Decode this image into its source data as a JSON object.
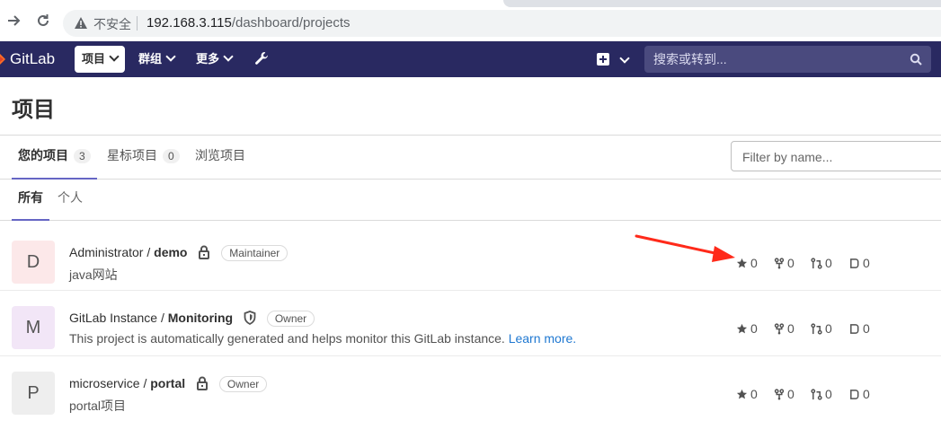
{
  "browser": {
    "insecure_label": "不安全",
    "url_host": "192.168.3.115",
    "url_path": "/dashboard/projects"
  },
  "header": {
    "brand": "GitLab",
    "menus": [
      "项目",
      "群组",
      "更多"
    ],
    "search_placeholder": "搜索或转到..."
  },
  "page": {
    "title": "项目",
    "tabs": [
      {
        "label": "您的项目",
        "count": "3"
      },
      {
        "label": "星标项目",
        "count": "0"
      },
      {
        "label": "浏览项目",
        "count": ""
      }
    ],
    "filter_placeholder": "Filter by name...",
    "subtabs": [
      "所有",
      "个人"
    ]
  },
  "projects": [
    {
      "avatar_letter": "D",
      "avatar_color": "#fce8e9",
      "namespace": "Administrator / ",
      "name": "demo",
      "visibility_icon": "lock-icon",
      "role": "Maintainer",
      "description": "java网站",
      "link_text": "",
      "stars": "0",
      "forks": "0",
      "merge_requests": "0",
      "issues": "0"
    },
    {
      "avatar_letter": "M",
      "avatar_color": "#f2e6f7",
      "namespace": "GitLab Instance / ",
      "name": "Monitoring",
      "visibility_icon": "shield-icon",
      "role": "Owner",
      "description": "This project is automatically generated and helps monitor this GitLab instance. ",
      "link_text": "Learn more.",
      "stars": "0",
      "forks": "0",
      "merge_requests": "0",
      "issues": "0"
    },
    {
      "avatar_letter": "P",
      "avatar_color": "#eeeeee",
      "namespace": "microservice / ",
      "name": "portal",
      "visibility_icon": "lock-icon",
      "role": "Owner",
      "description": "portal项目",
      "link_text": "",
      "stars": "0",
      "forks": "0",
      "merge_requests": "0",
      "issues": "0"
    }
  ],
  "colors": {
    "header_bg": "#292961",
    "accent": "#6666c4",
    "annotation_arrow": "#ff2a1a"
  }
}
